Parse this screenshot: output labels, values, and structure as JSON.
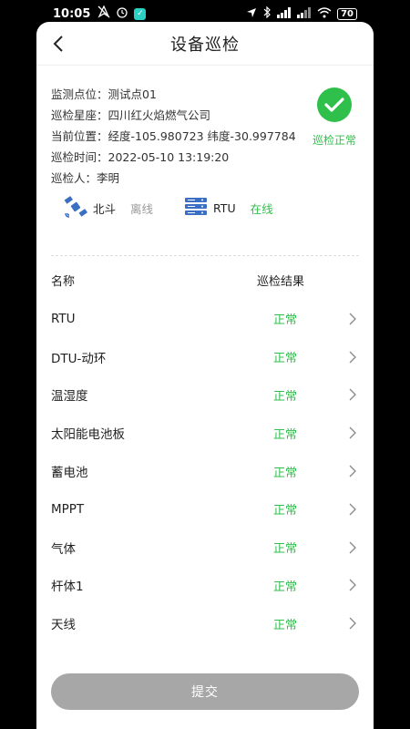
{
  "status_bar": {
    "time": "10:05",
    "battery": "70"
  },
  "header": {
    "title": "设备巡检"
  },
  "info": {
    "rows": [
      "监测点位：测试点01",
      "巡检星座：四川红火焰燃气公司",
      "当前位置：经度-105.980723  纬度-30.997784",
      "巡检时间：2022-05-10 13:19:20",
      "巡检人：李明"
    ],
    "status_label": "巡检正常",
    "devices": [
      {
        "name": "北斗",
        "state": "离线"
      },
      {
        "name": "RTU",
        "state": "在线"
      }
    ]
  },
  "table": {
    "col_name": "名称",
    "col_result": "巡检结果",
    "items": [
      {
        "name": "RTU",
        "result": "正常"
      },
      {
        "name": "DTU-动环",
        "result": "正常"
      },
      {
        "name": "温湿度",
        "result": "正常"
      },
      {
        "name": "太阳能电池板",
        "result": "正常"
      },
      {
        "name": "蓄电池",
        "result": "正常"
      },
      {
        "name": "MPPT",
        "result": "正常"
      },
      {
        "name": "气体",
        "result": "正常"
      },
      {
        "name": "杆体1",
        "result": "正常"
      },
      {
        "name": "天线",
        "result": "正常"
      }
    ]
  },
  "submit_label": "提交",
  "colors": {
    "accent_green": "#2fbf4b",
    "button_gray": "#a7a7a7"
  }
}
